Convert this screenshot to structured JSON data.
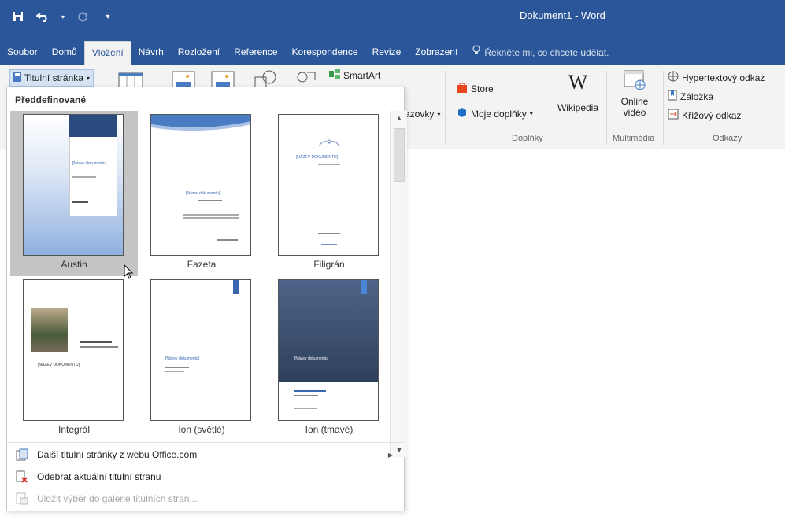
{
  "window": {
    "title": "Dokument1  -  Word"
  },
  "tabs": [
    {
      "label": "Soubor"
    },
    {
      "label": "Domů"
    },
    {
      "label": "Vložení"
    },
    {
      "label": "Návrh"
    },
    {
      "label": "Rozložení"
    },
    {
      "label": "Reference"
    },
    {
      "label": "Korespondence"
    },
    {
      "label": "Revize"
    },
    {
      "label": "Zobrazení"
    }
  ],
  "tell_me": "Řekněte mi, co chcete udělat.",
  "ribbon": {
    "cover_page": "Titulní stránka",
    "smartart": "SmartArt",
    "screenshot_partial": "azovky",
    "store": "Store",
    "my_addins": "Moje doplňky",
    "wikipedia": "Wikipedia",
    "wiki_glyph": "W",
    "online_video_line1": "Online",
    "online_video_line2": "video",
    "hyperlink": "Hypertextový odkaz",
    "bookmark": "Záložka",
    "cross_ref": "Křížový odkaz",
    "group_addins": "Doplňky",
    "group_media": "Multimédia",
    "group_links": "Odkazy"
  },
  "dropdown": {
    "header": "Předdefinované",
    "thumbnails": [
      {
        "label": "Austin"
      },
      {
        "label": "Fazeta"
      },
      {
        "label": "Filigrán"
      },
      {
        "label": "Integrál"
      },
      {
        "label": "Ion (světlé)"
      },
      {
        "label": "Ion (tmavé)"
      }
    ],
    "thumb_text": {
      "austin_title": "[Název dokumentu]",
      "fazeta_title": "[Název dokumentu]",
      "filigran_title": "[NÁZEV DOKUMENTU]",
      "integral_title": "[NÁZEV DOKUMENTU]",
      "ion_light_title": "[Název dokumentu]",
      "ion_dark_title": "[Název dokumentu]"
    },
    "menu": [
      {
        "label": "Další titulní stránky z webu Office.com",
        "has_submenu": true,
        "disabled": false
      },
      {
        "label": "Odebrat aktuální titulní stranu",
        "has_submenu": false,
        "disabled": false
      },
      {
        "label": "Uložit výběr do galerie titulních stran...",
        "has_submenu": false,
        "disabled": true
      }
    ]
  },
  "colors": {
    "accent": "#2b579a",
    "ribbon_bg": "#f3f3f3",
    "selection": "#c4c4c4"
  }
}
